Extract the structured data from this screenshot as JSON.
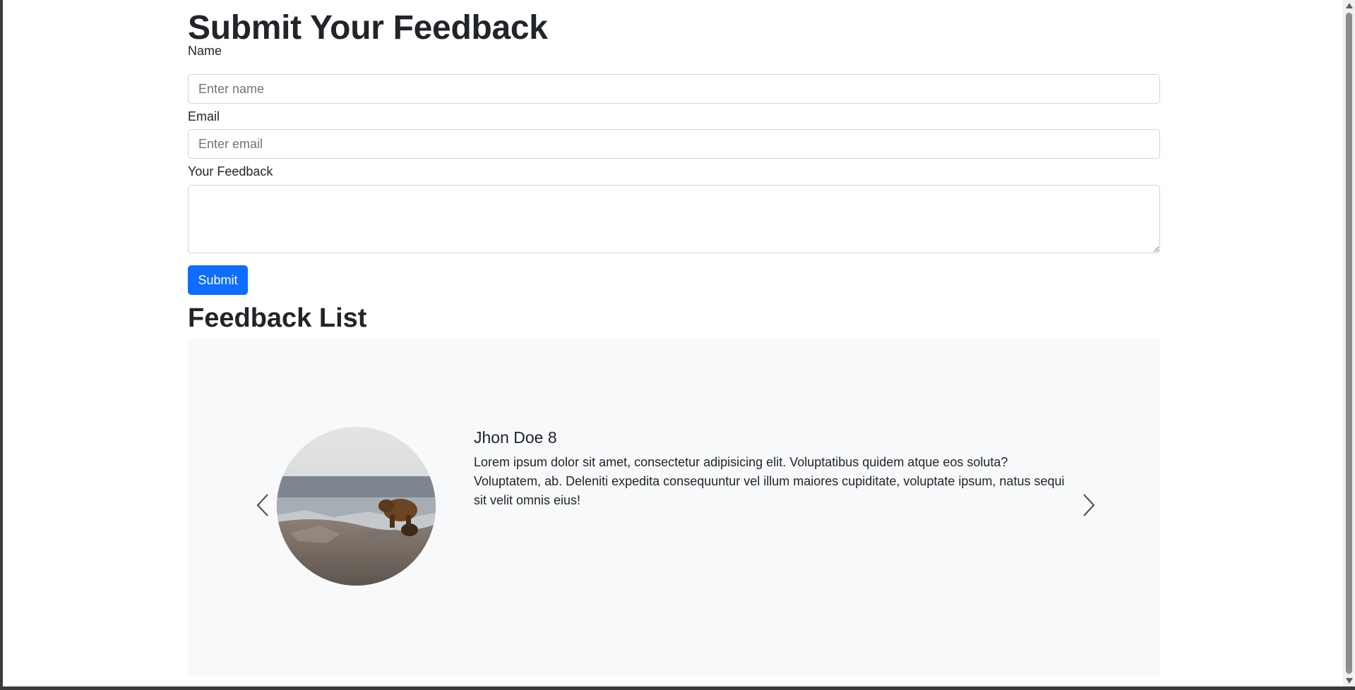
{
  "form": {
    "title": "Submit Your Feedback",
    "name_label": "Name",
    "name_placeholder": "Enter name",
    "email_label": "Email",
    "email_placeholder": "Enter email",
    "feedback_label": "Your Feedback",
    "submit_label": "Submit"
  },
  "feedback_list": {
    "title": "Feedback List",
    "current_item": {
      "name": "Jhon Doe 8",
      "text": "Lorem ipsum dolor sit amet, consectetur adipisicing elit. Voluptatibus quidem atque eos soluta? Voluptatem, ab. Deleniti expedita consequuntur vel illum maiores cupiditate, voluptate ipsum, natus sequi sit velit omnis eius!",
      "image": "bear-on-rocks-photo"
    },
    "prev_icon": "chevron-left-icon",
    "next_icon": "chevron-right-icon"
  },
  "colors": {
    "primary": "#0d6efd",
    "carousel_bg": "#f8f9fa",
    "border": "#ced4da"
  }
}
